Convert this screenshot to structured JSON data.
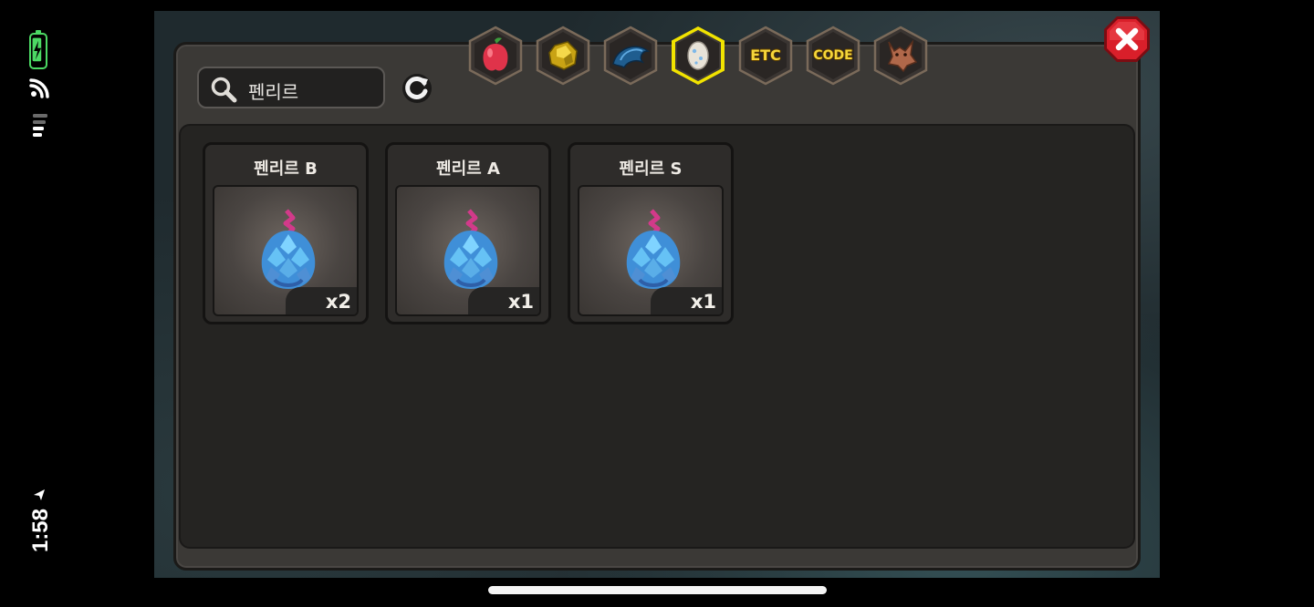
{
  "status": {
    "time": "1:58"
  },
  "search": {
    "value": "펜리르"
  },
  "tabs": [
    {
      "name": "fruit",
      "label": ""
    },
    {
      "name": "ore",
      "label": ""
    },
    {
      "name": "scale",
      "label": ""
    },
    {
      "name": "egg",
      "label": "",
      "selected": true
    },
    {
      "name": "etc",
      "label": "ETC"
    },
    {
      "name": "code",
      "label": "CODE"
    },
    {
      "name": "wolf",
      "label": ""
    }
  ],
  "items": [
    {
      "name": "펜리르 B",
      "qty": "x2"
    },
    {
      "name": "펜리르 A",
      "qty": "x1"
    },
    {
      "name": "펜리르 S",
      "qty": "x1"
    }
  ],
  "colors": {
    "selected_tab": "#f1e300",
    "accent": "#f5d63a",
    "close": "#d91f2a"
  }
}
